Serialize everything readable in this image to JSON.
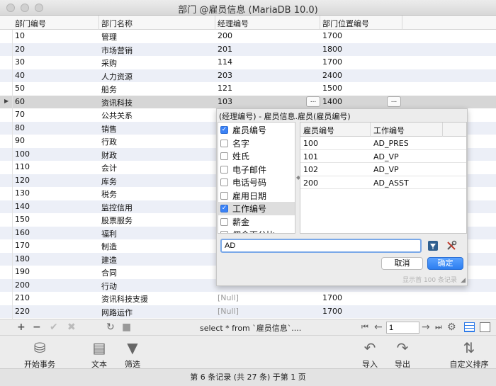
{
  "window": {
    "title": "部门 @雇员信息 (MariaDB 10.0)"
  },
  "grid": {
    "columns": [
      "部门编号",
      "部门名称",
      "经理编号",
      "部门位置编号"
    ],
    "rows": [
      [
        "10",
        "管理",
        "200",
        "1700"
      ],
      [
        "20",
        "市场营销",
        "201",
        "1800"
      ],
      [
        "30",
        "采购",
        "114",
        "1700"
      ],
      [
        "40",
        "人力资源",
        "203",
        "2400"
      ],
      [
        "50",
        "船务",
        "121",
        "1500"
      ],
      [
        "60",
        "资讯科技",
        "103",
        "1400"
      ],
      [
        "70",
        "公共关系",
        "",
        ""
      ],
      [
        "80",
        "销售",
        "",
        ""
      ],
      [
        "90",
        "行政",
        "",
        ""
      ],
      [
        "100",
        "财政",
        "",
        ""
      ],
      [
        "110",
        "会计",
        "",
        ""
      ],
      [
        "120",
        "库务",
        "",
        ""
      ],
      [
        "130",
        "税务",
        "",
        ""
      ],
      [
        "140",
        "监控信用",
        "",
        ""
      ],
      [
        "150",
        "股票服务",
        "",
        ""
      ],
      [
        "160",
        "福利",
        "",
        ""
      ],
      [
        "170",
        "制造",
        "",
        ""
      ],
      [
        "180",
        "建造",
        "",
        ""
      ],
      [
        "190",
        "合同",
        "",
        ""
      ],
      [
        "200",
        "行动",
        "",
        ""
      ],
      [
        "210",
        "资讯科技支援",
        "[Null]",
        "1700"
      ],
      [
        "220",
        "网路运作",
        "[Null]",
        "1700"
      ]
    ],
    "selected_row_index": 5,
    "ellipsis_label": "..."
  },
  "lookup_popup": {
    "title": "(经理编号) - 雇员信息.雇员(雇员编号)",
    "fields": [
      {
        "label": "雇员编号",
        "checked": true
      },
      {
        "label": "名字",
        "checked": false
      },
      {
        "label": "姓氏",
        "checked": false
      },
      {
        "label": "电子邮件",
        "checked": false
      },
      {
        "label": "电话号码",
        "checked": false
      },
      {
        "label": "雇用日期",
        "checked": false
      },
      {
        "label": "工作编号",
        "checked": true
      },
      {
        "label": "薪金",
        "checked": false
      },
      {
        "label": "佣金百分比",
        "checked": false
      }
    ],
    "highlighted_field_index": 6,
    "columns": [
      "雇员编号",
      "工作编号"
    ],
    "rows": [
      [
        "100",
        "AD_PRES"
      ],
      [
        "101",
        "AD_VP"
      ],
      [
        "102",
        "AD_VP"
      ],
      [
        "200",
        "AD_ASST"
      ]
    ],
    "search_value": "AD",
    "cancel_label": "取消",
    "ok_label": "确定",
    "status_text": "显示首 100 条记录"
  },
  "bottom_toolbar": {
    "sql_text": "select * from `雇员信息`....",
    "page_value": "1"
  },
  "main_toolbar": {
    "tools": [
      {
        "label": "开始事务",
        "icon": "begin-transaction-icon"
      },
      {
        "label": "文本",
        "icon": "text-icon"
      },
      {
        "label": "筛选",
        "icon": "filter-icon"
      },
      {
        "label": "导入",
        "icon": "import-icon"
      },
      {
        "label": "导出",
        "icon": "export-icon"
      },
      {
        "label": "自定义排序",
        "icon": "custom-sort-icon"
      }
    ]
  },
  "status_bar": {
    "text": "第 6 条记录 (共 27 条) 于第 1 页"
  },
  "colors": {
    "accent": "#3b82f6",
    "row_alt": "#eceff7",
    "selected_row": "#d6d6d6"
  }
}
